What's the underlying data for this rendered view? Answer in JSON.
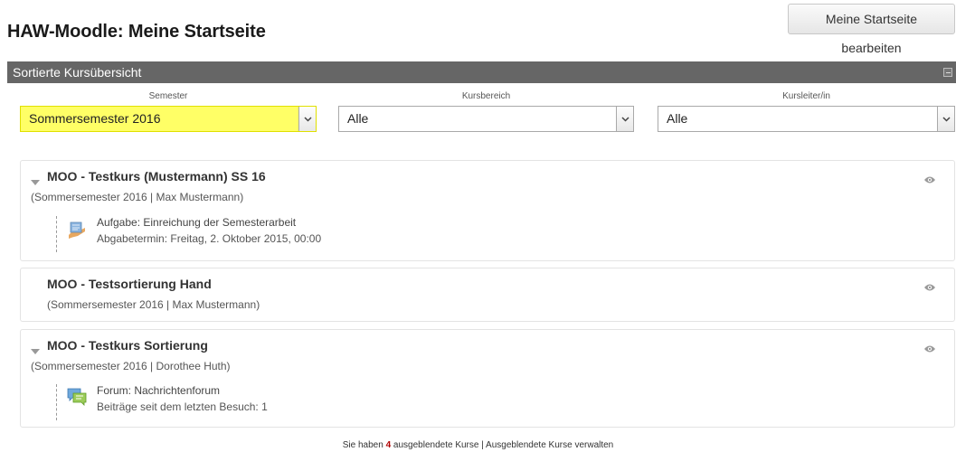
{
  "page": {
    "title": "HAW-Moodle: Meine Startseite",
    "edit_button": "Meine Startseite bearbeiten"
  },
  "block": {
    "title": "Sortierte Kursübersicht"
  },
  "filters": {
    "semester": {
      "label": "Semester",
      "value": "Sommersemester 2016"
    },
    "kursbereich": {
      "label": "Kursbereich",
      "value": "Alle"
    },
    "kursleiter": {
      "label": "Kursleiter/in",
      "value": "Alle"
    }
  },
  "courses": [
    {
      "title": "MOO - Testkurs (Mustermann) SS 16",
      "meta": "(Sommersemester 2016  |  Max  Mustermann)",
      "expanded": true,
      "activity": {
        "icon": "assignment-icon",
        "name": "Aufgabe: Einreichung der Semesterarbeit",
        "sub": "Abgabetermin: Freitag, 2. Oktober 2015, 00:00"
      }
    },
    {
      "title": "MOO - Testsortierung Hand",
      "meta": "(Sommersemester 2016  |  Max  Mustermann)",
      "expanded": false
    },
    {
      "title": "MOO - Testkurs Sortierung",
      "meta": "(Sommersemester 2016  |  Dorothee Huth)",
      "expanded": true,
      "activity": {
        "icon": "forum-icon",
        "name": "Forum: Nachrichtenforum",
        "sub": "Beiträge seit dem letzten Besuch: 1"
      }
    }
  ],
  "footer": {
    "prefix": "Sie haben ",
    "count": "4",
    "middle": " ausgeblendete Kurse | ",
    "link": "Ausgeblendete Kurse verwalten"
  },
  "colors": {
    "header_bg": "#666666",
    "highlight_select": "#ffff66",
    "count_color": "#b00000"
  }
}
